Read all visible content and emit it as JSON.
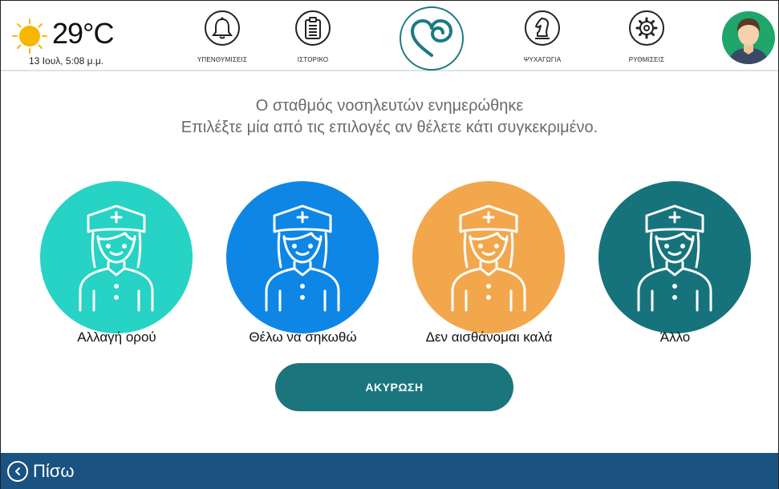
{
  "weather": {
    "temperature": "29°C",
    "date": "13 Ιουλ, 5:08 μ.μ.",
    "icon": "sun-icon"
  },
  "nav": {
    "reminders": {
      "label": "ΥΠΕΝΘΥΜΙΣΕΙΣ",
      "icon": "bell-icon"
    },
    "history": {
      "label": "ΙΣΤΟΡΙΚΟ",
      "icon": "clipboard-icon"
    },
    "logo": {
      "icon": "heart-logo-icon"
    },
    "entertainment": {
      "label": "ΨΥΧΑΓΩΓΙΑ",
      "icon": "chess-knight-icon"
    },
    "settings": {
      "label": "ΡΥΘΜΙΣΕΙΣ",
      "icon": "gear-icon"
    }
  },
  "message": {
    "line1": "Ο σταθμός νοσηλευτών ενημερώθηκε",
    "line2": "Επιλέξτε μία από τις επιλογές αν θέλετε κάτι συγκεκριμένο."
  },
  "options": [
    {
      "label": "Αλλαγή ορού",
      "color": "#26d3c4"
    },
    {
      "label": "Θέλω να σηκωθώ",
      "color": "#0e86e6"
    },
    {
      "label": "Δεν αισθάνομαι καλά",
      "color": "#f3a74c"
    },
    {
      "label": "Άλλο",
      "color": "#16737b"
    }
  ],
  "cancel": {
    "label": "ΑΚΥΡΩΣΗ"
  },
  "footer": {
    "back_label": "Πίσω"
  },
  "colors": {
    "accent": "#1b757d",
    "footer": "#1a5281",
    "avatar": "#1fa66b"
  }
}
